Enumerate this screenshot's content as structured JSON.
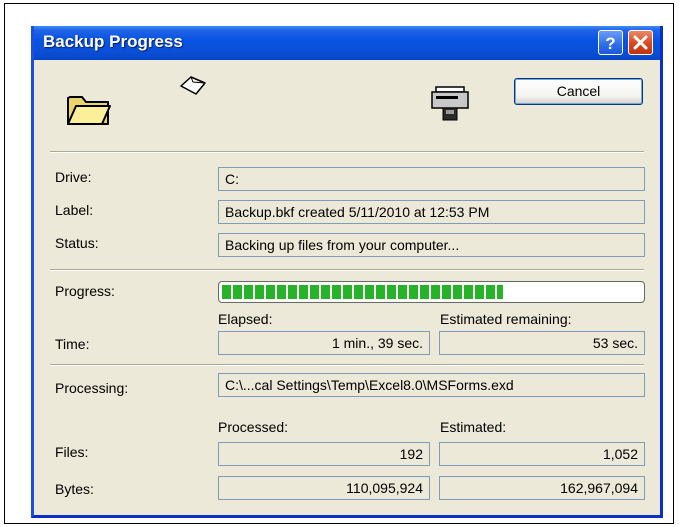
{
  "window": {
    "title": "Backup Progress",
    "buttons": {
      "help_label": "?",
      "cancel_label": "Cancel"
    }
  },
  "icons": [
    "folder-icon",
    "flying-document-icon",
    "backup-drive-icon",
    "help-icon",
    "close-icon"
  ],
  "fields": {
    "drive_label": "Drive:",
    "drive_value": "C:",
    "label_label": "Label:",
    "label_value": "Backup.bkf created 5/11/2010 at 12:53 PM",
    "status_label": "Status:",
    "status_value": "Backing up files from your computer...",
    "progress_label": "Progress:",
    "progress_fraction": 0.67,
    "elapsed_header": "Elapsed:",
    "remaining_header": "Estimated remaining:",
    "time_label": "Time:",
    "elapsed_value": "1 min., 39 sec.",
    "remaining_value": "53 sec.",
    "processing_label": "Processing:",
    "processing_value": "C:\\...cal Settings\\Temp\\Excel8.0\\MSForms.exd",
    "processed_header": "Processed:",
    "estimated_header": "Estimated:",
    "files_label": "Files:",
    "files_processed": "192",
    "files_estimated": "1,052",
    "bytes_label": "Bytes:",
    "bytes_processed": "110,095,924",
    "bytes_estimated": "162,967,094"
  },
  "colors": {
    "titlebar": "#0854e3",
    "dialog_bg": "#ece9d8",
    "progress": "#27b327",
    "close_button": "#d9471f"
  }
}
